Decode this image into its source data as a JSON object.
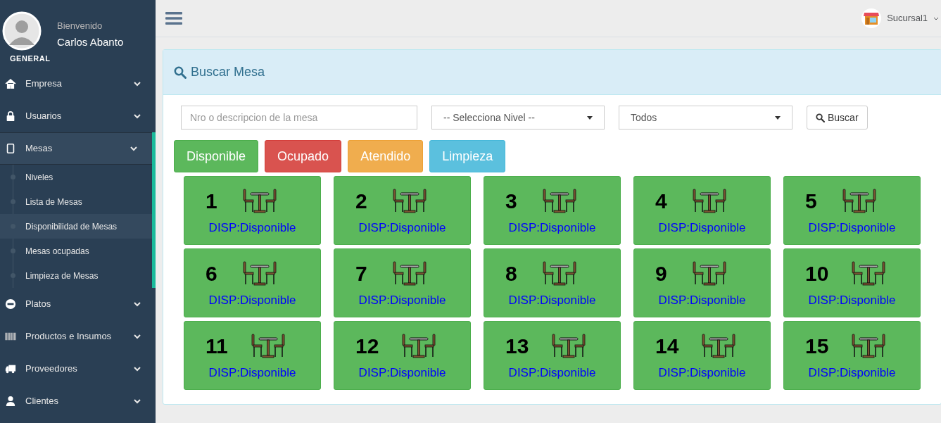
{
  "user": {
    "greeting": "Bienvenido",
    "name": "Carlos Abanto",
    "role": "GENERAL"
  },
  "menu": [
    {
      "kind": "home",
      "label": "Empresa",
      "expanded": false
    },
    {
      "kind": "lock",
      "label": "Usuarios",
      "expanded": false
    },
    {
      "kind": "tablet",
      "label": "Mesas",
      "expanded": true,
      "children": [
        {
          "label": "Niveles",
          "selected": false
        },
        {
          "label": "Lista de Mesas",
          "selected": false
        },
        {
          "label": "Disponibilidad de Mesas",
          "selected": true
        },
        {
          "label": "Mesas ocupadas",
          "selected": false
        },
        {
          "label": "Limpieza de Mesas",
          "selected": false
        }
      ]
    },
    {
      "kind": "minus",
      "label": "Platos",
      "expanded": false
    },
    {
      "kind": "barcode",
      "label": "Productos e Insumos",
      "expanded": false
    },
    {
      "kind": "truck",
      "label": "Proveedores",
      "expanded": false
    },
    {
      "kind": "user",
      "label": "Clientes",
      "expanded": false
    }
  ],
  "topbar": {
    "branch": "Sucursal1"
  },
  "panel": {
    "title": "Buscar Mesa",
    "search": {
      "placeholder": "Nro o descripcion de la mesa"
    },
    "level_select": "-- Selecciona Nivel --",
    "status_select": "Todos",
    "search_button": "Buscar"
  },
  "legend": [
    {
      "kind": "disponible",
      "label": "Disponible"
    },
    {
      "kind": "ocupado",
      "label": "Ocupado"
    },
    {
      "kind": "atendido",
      "label": "Atendido"
    },
    {
      "kind": "limpieza",
      "label": "Limpieza"
    }
  ],
  "tables": [
    {
      "number": "1",
      "kind": "disponible",
      "status": "DISP:Disponible"
    },
    {
      "number": "2",
      "kind": "disponible",
      "status": "DISP:Disponible"
    },
    {
      "number": "3",
      "kind": "disponible",
      "status": "DISP:Disponible"
    },
    {
      "number": "4",
      "kind": "disponible",
      "status": "DISP:Disponible"
    },
    {
      "number": "5",
      "kind": "disponible",
      "status": "DISP:Disponible"
    },
    {
      "number": "6",
      "kind": "disponible",
      "status": "DISP:Disponible"
    },
    {
      "number": "7",
      "kind": "disponible",
      "status": "DISP:Disponible"
    },
    {
      "number": "8",
      "kind": "disponible",
      "status": "DISP:Disponible"
    },
    {
      "number": "9",
      "kind": "disponible",
      "status": "DISP:Disponible"
    },
    {
      "number": "10",
      "kind": "disponible",
      "status": "DISP:Disponible"
    },
    {
      "number": "11",
      "kind": "disponible",
      "status": "DISP:Disponible"
    },
    {
      "number": "12",
      "kind": "disponible",
      "status": "DISP:Disponible"
    },
    {
      "number": "13",
      "kind": "disponible",
      "status": "DISP:Disponible"
    },
    {
      "number": "14",
      "kind": "disponible",
      "status": "DISP:Disponible"
    },
    {
      "number": "15",
      "kind": "disponible",
      "status": "DISP:Disponible"
    }
  ]
}
